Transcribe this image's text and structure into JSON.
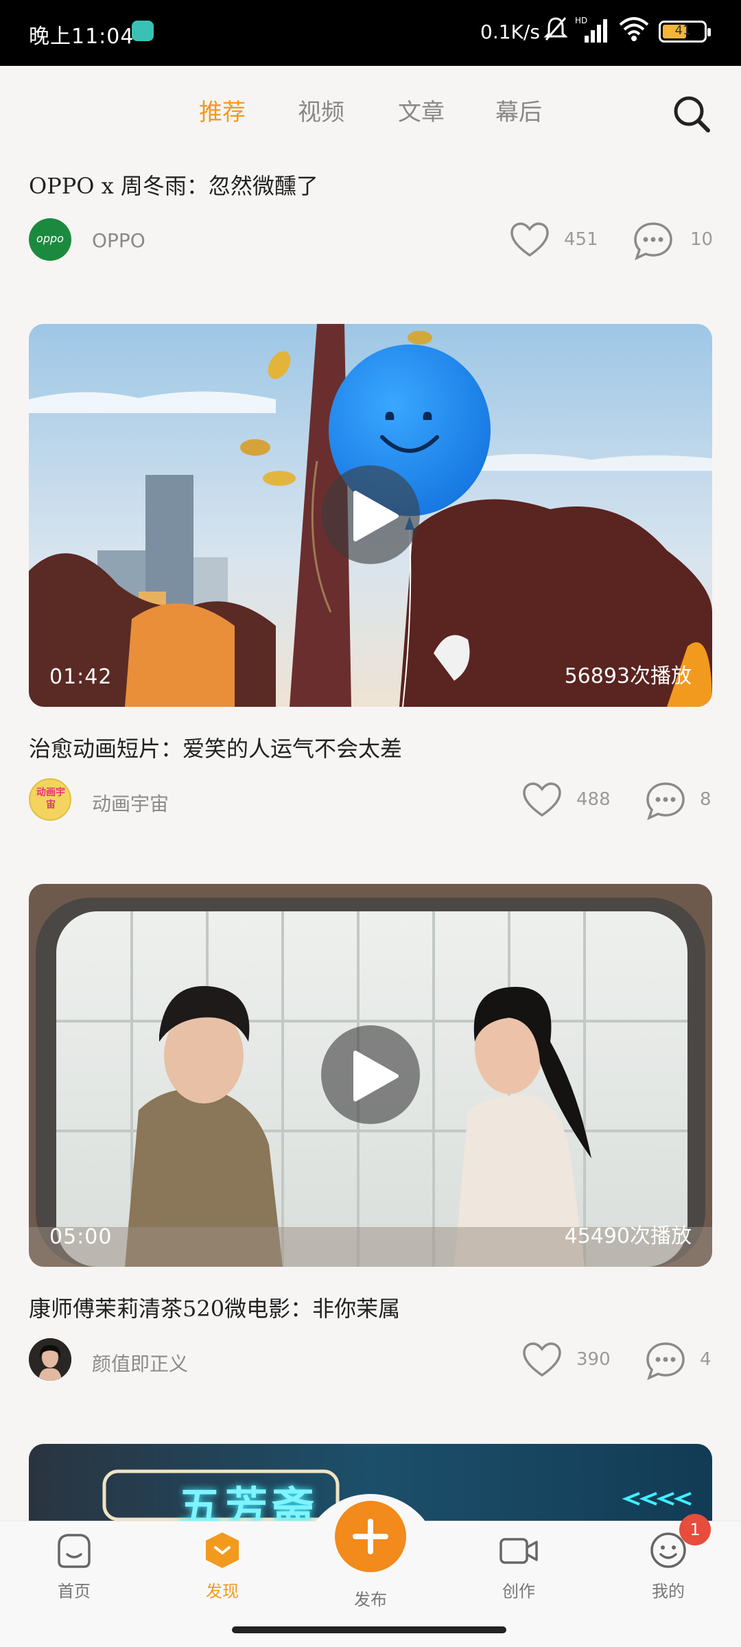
{
  "status_bar": {
    "time": "晚上11:04",
    "net_speed": "0.1K/s",
    "battery": "41"
  },
  "tabs": [
    {
      "label": "推荐",
      "active": true
    },
    {
      "label": "视频",
      "active": false
    },
    {
      "label": "文章",
      "active": false
    },
    {
      "label": "幕后",
      "active": false
    }
  ],
  "posts": [
    {
      "title": "OPPO x 周冬雨：忽然微醺了",
      "author": "OPPO",
      "avatar_text": "oppo",
      "likes": "451",
      "comments": "10"
    },
    {
      "duration": "01:42",
      "plays": "56893次播放",
      "title": "治愈动画短片：爱笑的人运气不会太差",
      "author": "动画宇宙",
      "avatar_text": "动画宇宙",
      "likes": "488",
      "comments": "8"
    },
    {
      "duration": "05:00",
      "plays": "45490次播放",
      "title": "康师傅茉莉清茶520微电影：非你茉属",
      "author": "颜值即正义",
      "likes": "390",
      "comments": "4"
    },
    {
      "sign_text": "五芳斋"
    }
  ],
  "bottom_nav": [
    {
      "label": "首页",
      "icon": "home-icon"
    },
    {
      "label": "发现",
      "icon": "discover-icon",
      "active": true
    },
    {
      "label": "发布",
      "icon": "publish-plus-icon"
    },
    {
      "label": "创作",
      "icon": "video-camera-icon"
    },
    {
      "label": "我的",
      "icon": "smiley-profile-icon"
    }
  ],
  "notification_badge": "1",
  "colors": {
    "accent": "#f29a1e",
    "publish": "#f28a1c",
    "oppo_green": "#1b8a3f",
    "badge": "#e74c3c"
  }
}
